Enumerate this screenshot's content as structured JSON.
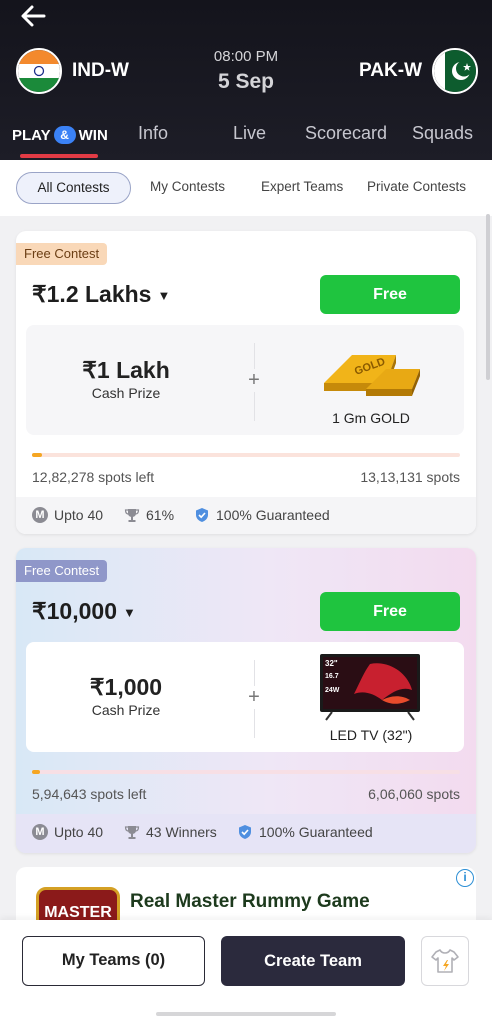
{
  "match": {
    "team_home": "IND-W",
    "team_away": "PAK-W",
    "time": "08:00 PM",
    "date": "5 Sep"
  },
  "tabs": {
    "play_win": {
      "play": "PLAY",
      "amp": "&",
      "win": "WIN"
    },
    "items": [
      "Info",
      "Live",
      "Scorecard",
      "Squads"
    ]
  },
  "filters": [
    "All Contests",
    "My Contests",
    "Expert Teams",
    "Private Contests"
  ],
  "contests": [
    {
      "badge": "Free Contest",
      "prize_pool": "₹1.2 Lakhs",
      "join_label": "Free",
      "cash_prize": "₹1 Lakh",
      "cash_label": "Cash Prize",
      "bonus_label": "1 Gm GOLD",
      "bonus_image_text": "GOLD",
      "progress_fraction": 0.024,
      "spots_left": "12,82,278 spots left",
      "total_spots": "13,13,131 spots",
      "max_entries": "Upto 40",
      "max_entries_icon_text": "M",
      "winners": "61%",
      "guarantee": "100% Guaranteed"
    },
    {
      "badge": "Free Contest",
      "prize_pool": "₹10,000",
      "join_label": "Free",
      "cash_prize": "₹1,000",
      "cash_label": "Cash Prize",
      "bonus_label": "LED TV (32\")",
      "tv_text": {
        "size": "32\"",
        "tag": "16.7",
        "power": "24W"
      },
      "progress_fraction": 0.019,
      "spots_left": "5,94,643 spots left",
      "total_spots": "6,06,060 spots",
      "max_entries": "Upto 40",
      "max_entries_icon_text": "M",
      "winners": "43 Winners",
      "guarantee": "100% Guaranteed"
    }
  ],
  "ad": {
    "title": "Real Master Rummy Game",
    "logo_text": "MASTER",
    "info": "i"
  },
  "bottom": {
    "my_teams": "My Teams  (0)",
    "create_team": "Create Team"
  },
  "colors": {
    "join_green": "#1fc43f",
    "tab_underline": "#e23b45",
    "create_team_bg": "#2b2a3d"
  }
}
